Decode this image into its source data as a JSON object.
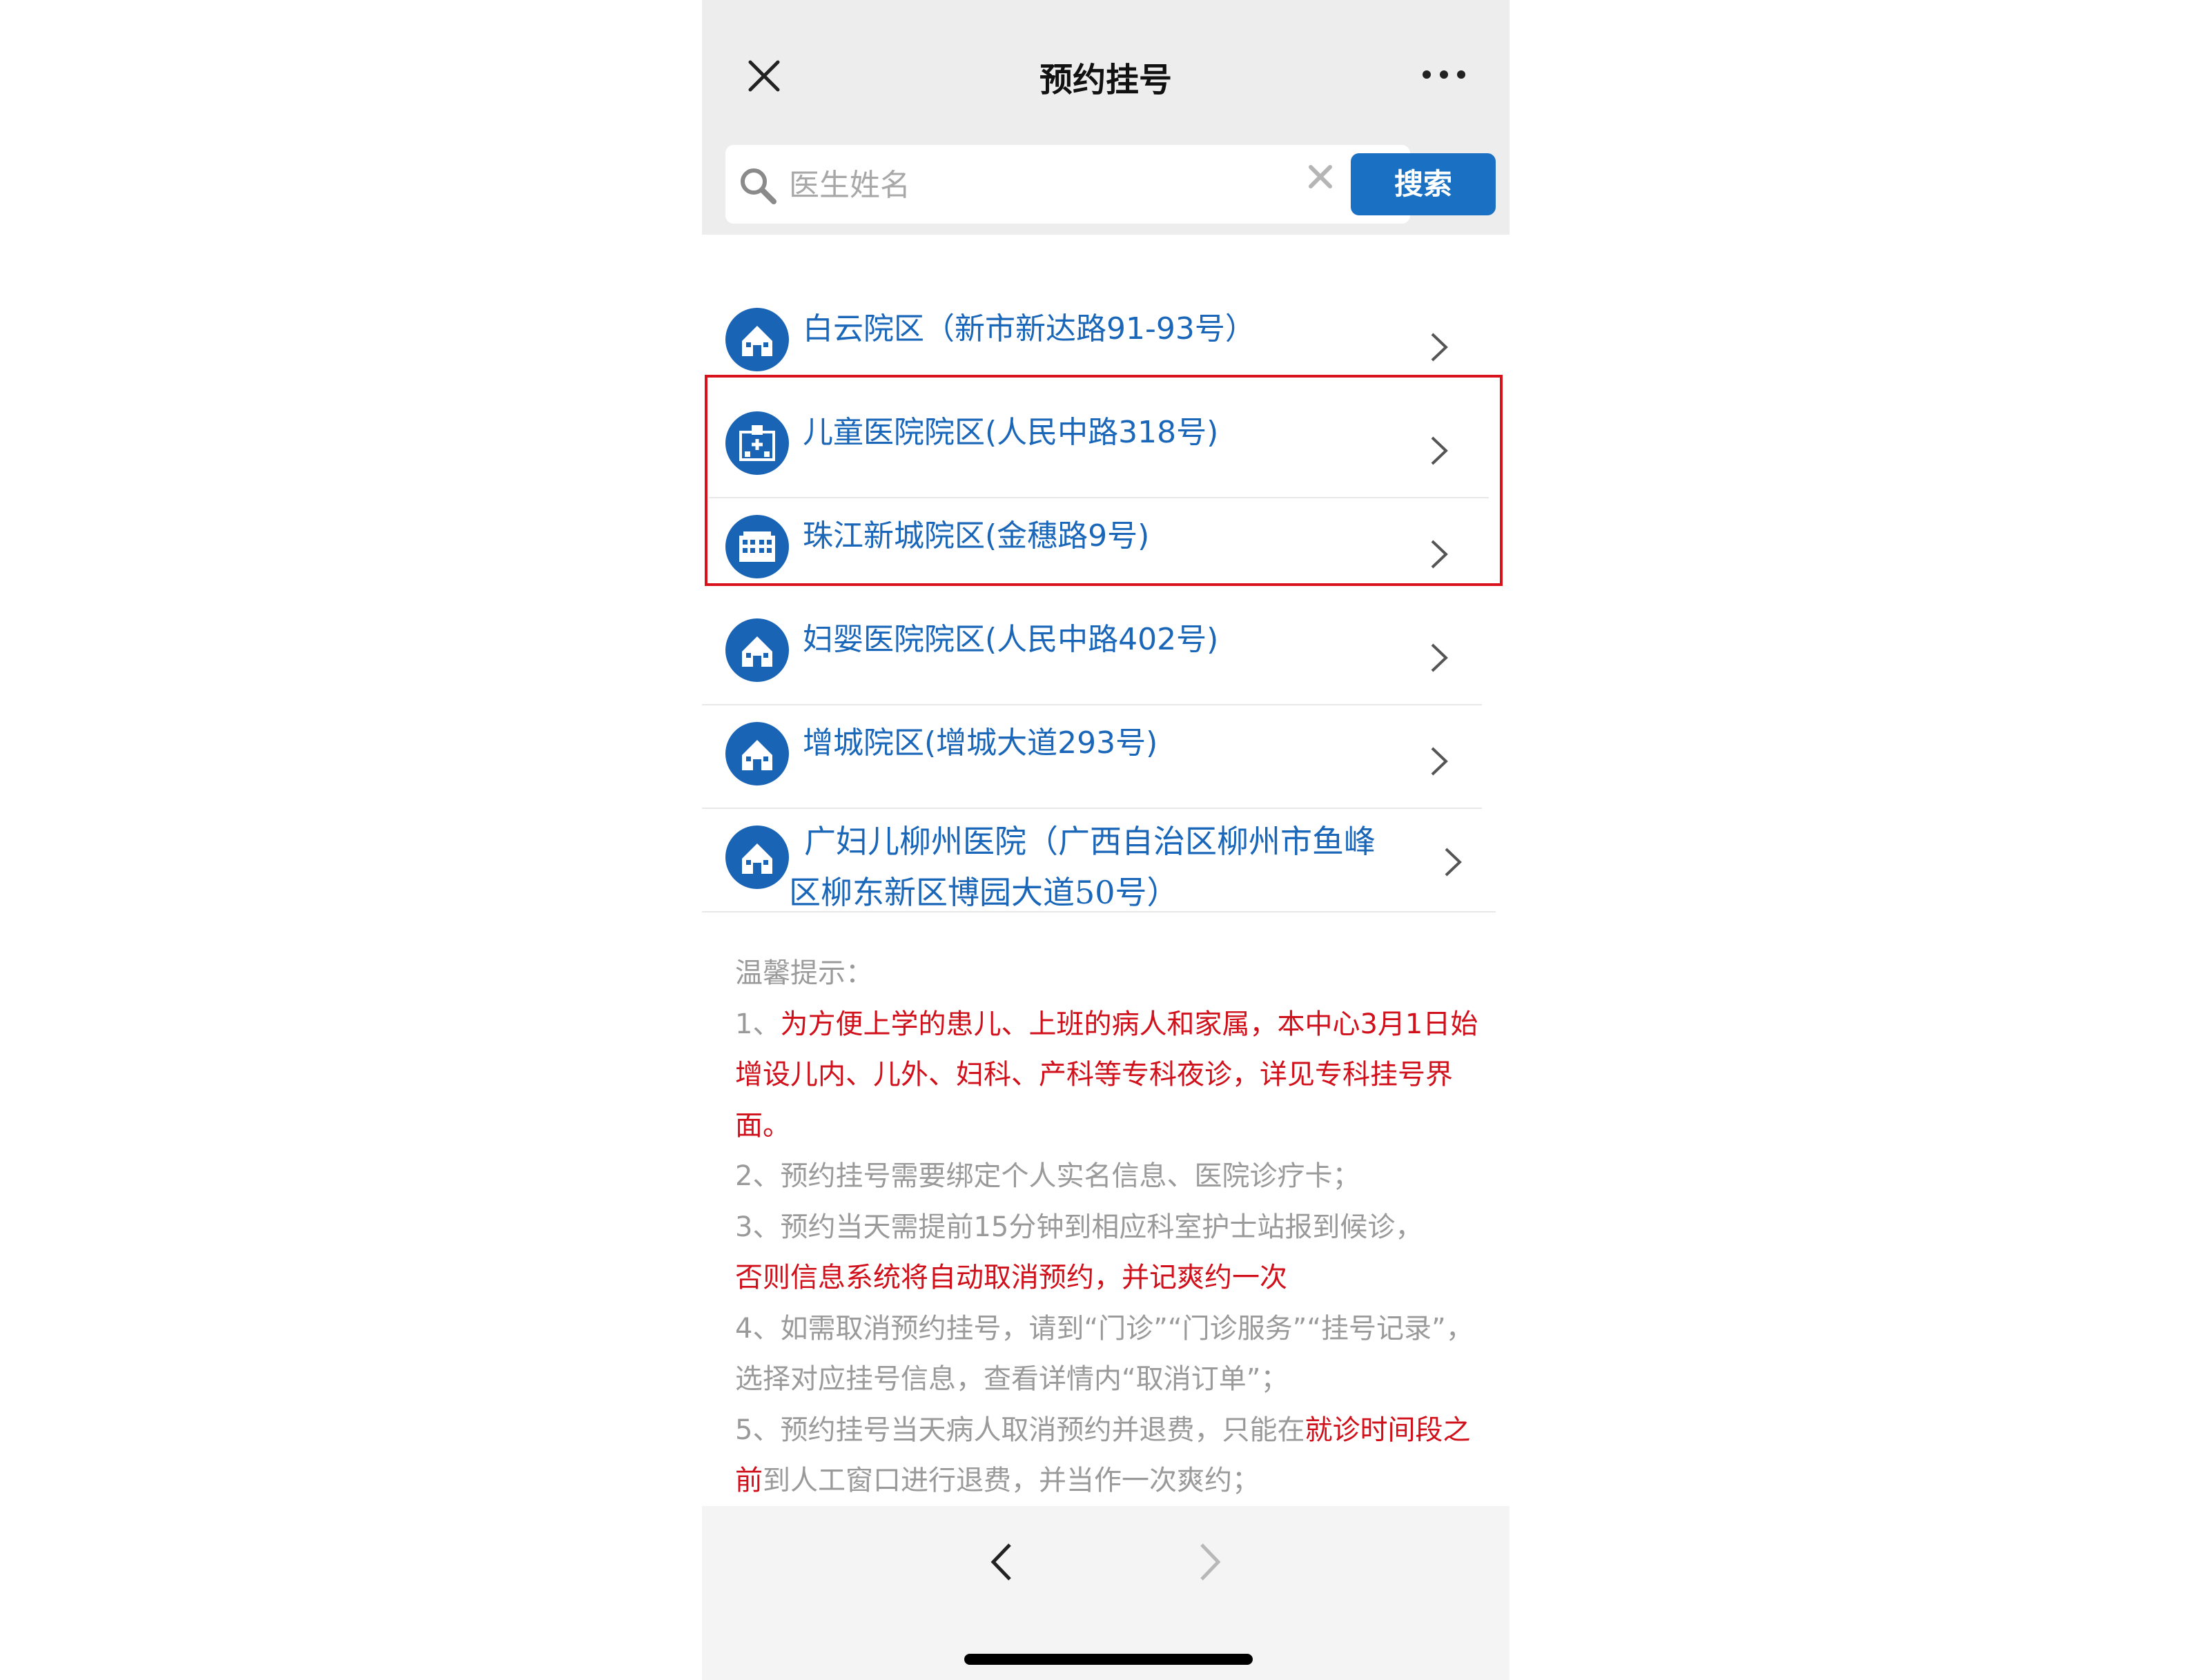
{
  "header": {
    "title": "预约挂号",
    "close_icon": "close-icon",
    "more_icon": "more-dots-icon"
  },
  "search": {
    "placeholder": "医生姓名",
    "value": "",
    "button_label": "搜索",
    "clear_icon": "clear-x-icon"
  },
  "campuses": [
    {
      "label": "白云院区（新市新达路91-93号）",
      "icon": "hospital-building-icon"
    },
    {
      "label": "儿童医院院区(人民中路318号)",
      "icon": "hospital-cross-icon"
    },
    {
      "label": "珠江新城院区(金穗路9号)",
      "icon": "building-grid-icon"
    },
    {
      "label": "妇婴医院院区(人民中路402号)",
      "icon": "hospital-building-icon"
    },
    {
      "label": "增城院区(增城大道293号)",
      "icon": "hospital-building-icon"
    },
    {
      "label_line1": "广妇儿柳州医院（广西自治区柳州市鱼峰",
      "label_line2": "区柳东新区博园大道50号）",
      "icon": "hospital-building-icon"
    }
  ],
  "tips": {
    "heading": "温馨提示：",
    "t1_num": "1、",
    "t1_text": "为方便上学的患儿、上班的病人和家属，本中心3月1日始增设儿内、儿外、妇科、产科等专科夜诊，详见专科挂号界面。",
    "t2": "2、预约挂号需要绑定个人实名信息、医院诊疗卡；",
    "t3_a": "3、预约当天需提前15分钟到相应科室护士站报到候诊，",
    "t3_b": "否则信息系统将自动取消预约，并记爽约一次",
    "t4": "4、如需取消预约挂号，请到“门诊”“门诊服务”“挂号记录”，选择对应挂号信息，查看详情内“取消订单”；",
    "t5_a": "5、预约挂号当天病人取消预约并退费，只能在",
    "t5_b": "就诊时间段之前",
    "t5_c": "到人工窗口进行退费，并当作一次爽约；"
  },
  "colors": {
    "link_blue": "#1a66b8",
    "button_blue": "#1a70c2",
    "alert_red": "#d0101a",
    "highlight_red": "#d8121a"
  }
}
